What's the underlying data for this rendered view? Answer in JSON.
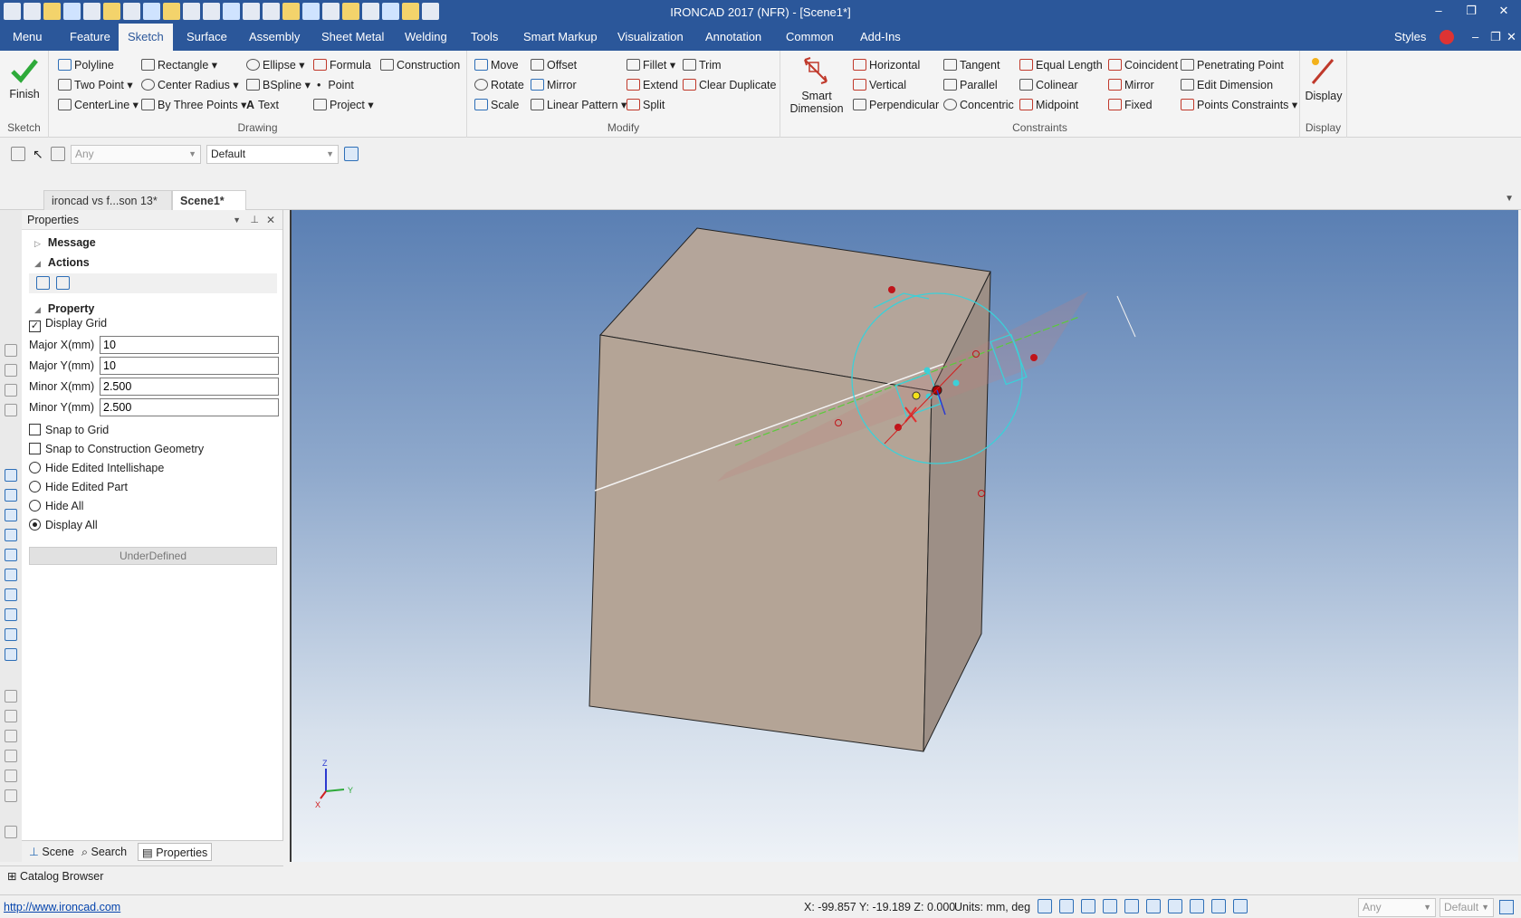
{
  "window": {
    "title": "IRONCAD 2017 (NFR) - [Scene1*]",
    "controls": [
      "–",
      "❐",
      "✕"
    ]
  },
  "ribbon_tabs": [
    "Menu",
    "Feature",
    "Sketch",
    "Surface",
    "Assembly",
    "Sheet Metal",
    "Welding",
    "Tools",
    "Smart Markup",
    "Visualization",
    "Annotation",
    "Common",
    "Add-Ins"
  ],
  "active_tab": "Sketch",
  "styles_label": "Styles",
  "ribbon": {
    "sketch": {
      "finish": "Finish",
      "title": "Sketch"
    },
    "drawing": {
      "title": "Drawing",
      "items": [
        "Polyline",
        "Rectangle",
        "Ellipse",
        "Formula",
        "Construction",
        "Two Point",
        "Center Radius",
        "BSpline",
        "Point",
        "CenterLine",
        "By Three Points",
        "Text",
        "Project"
      ]
    },
    "modify": {
      "title": "Modify",
      "items": [
        "Move",
        "Offset",
        "Fillet",
        "Trim",
        "Rotate",
        "Mirror",
        "Extend",
        "Clear Duplicate",
        "Scale",
        "Linear Pattern",
        "Split"
      ]
    },
    "constraints": {
      "title": "Constraints",
      "smart_dimension": [
        "Smart",
        "Dimension"
      ],
      "items": [
        "Horizontal",
        "Tangent",
        "Equal Length",
        "Coincident",
        "Penetrating Point",
        "Vertical",
        "Parallel",
        "Colinear",
        "Mirror",
        "Edit Dimension",
        "Perpendicular",
        "Concentric",
        "Midpoint",
        "Fixed",
        "Points Constraints"
      ]
    },
    "display": {
      "label": "Display",
      "title": "Display"
    }
  },
  "toolbar": {
    "filter": "Any",
    "style": "Default"
  },
  "doc_tabs": [
    "ironcad vs f...son 13*",
    "Scene1*"
  ],
  "properties": {
    "title": "Properties",
    "sections": {
      "message": "Message",
      "actions": "Actions",
      "property": "Property"
    },
    "display_grid": "Display Grid",
    "fields": [
      {
        "label": "Major X(mm)",
        "value": "10"
      },
      {
        "label": "Major Y(mm)",
        "value": "10"
      },
      {
        "label": "Minor X(mm)",
        "value": "2.500"
      },
      {
        "label": "Minor Y(mm)",
        "value": "2.500"
      }
    ],
    "checks": [
      "Snap to Grid",
      "Snap to Construction Geometry"
    ],
    "radios": [
      "Hide Edited Intellishape",
      "Hide Edited Part",
      "Hide All",
      "Display All"
    ],
    "selected_radio": "Display All",
    "status_button": "UnderDefined",
    "bottom_tabs": [
      "Scene",
      "Search",
      "Properties"
    ]
  },
  "catalog": "Catalog Browser",
  "status": {
    "url": "http://www.ironcad.com",
    "coords": "X: -99.857 Y: -19.189 Z: 0.000",
    "units": "Units: mm, deg",
    "filter": "Any",
    "style": "Default"
  },
  "axes": {
    "x": "X",
    "y": "Y",
    "z": "Z"
  }
}
